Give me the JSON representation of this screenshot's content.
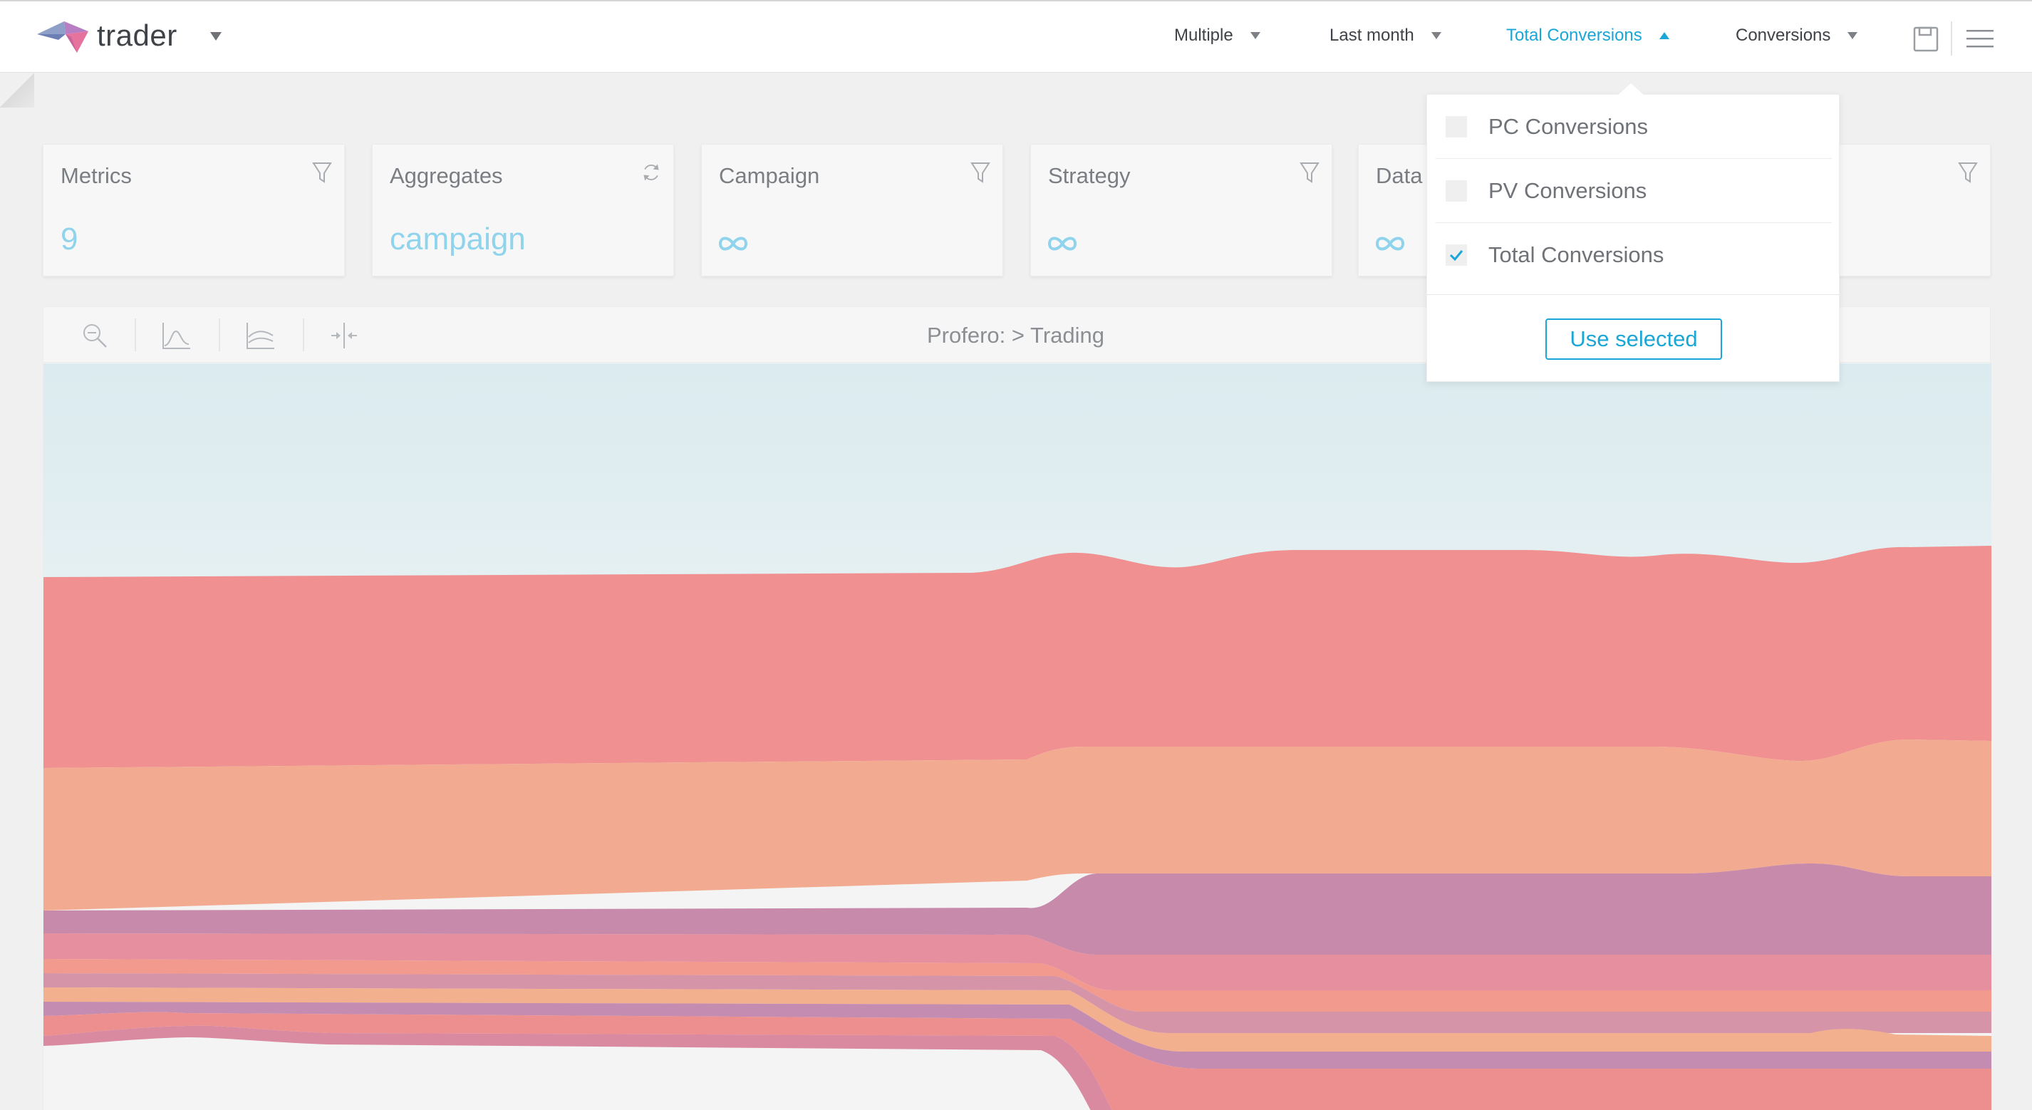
{
  "app": {
    "brand": "trader",
    "logo_icon": "trader-logo-icon"
  },
  "nav": {
    "items": [
      {
        "label": "Multiple"
      },
      {
        "label": "Last month"
      },
      {
        "label": "Total Conversions",
        "active": true
      },
      {
        "label": "Conversions"
      }
    ],
    "save_icon": "save-icon",
    "menu_icon": "hamburger-menu-icon"
  },
  "cards": [
    {
      "title": "Metrics",
      "value": "9",
      "icon": "filter-icon"
    },
    {
      "title": "Aggregates",
      "value": "campaign",
      "icon": "refresh-icon"
    },
    {
      "title": "Campaign",
      "value": "∞",
      "icon": "filter-icon"
    },
    {
      "title": "Strategy",
      "value": "∞",
      "icon": "filter-icon"
    },
    {
      "title": "Data",
      "value": "∞",
      "icon": "filter-icon"
    }
  ],
  "chart": {
    "breadcrumb": "Profero: > Trading",
    "tools": [
      "zoom-icon",
      "line-chart-icon",
      "area-chart-icon",
      "split-icon"
    ]
  },
  "dropdown": {
    "options": [
      {
        "label": "PC Conversions",
        "checked": false
      },
      {
        "label": "PV Conversions",
        "checked": false
      },
      {
        "label": "Total Conversions",
        "checked": true
      }
    ],
    "button": "Use selected"
  },
  "colors": {
    "accent": "#1aa6d6",
    "value": "#8fd3ec",
    "band_red": "#f09090",
    "band_orange": "#f2ab91",
    "band_purple": "#c88aab",
    "sky": "#dcecf0"
  }
}
